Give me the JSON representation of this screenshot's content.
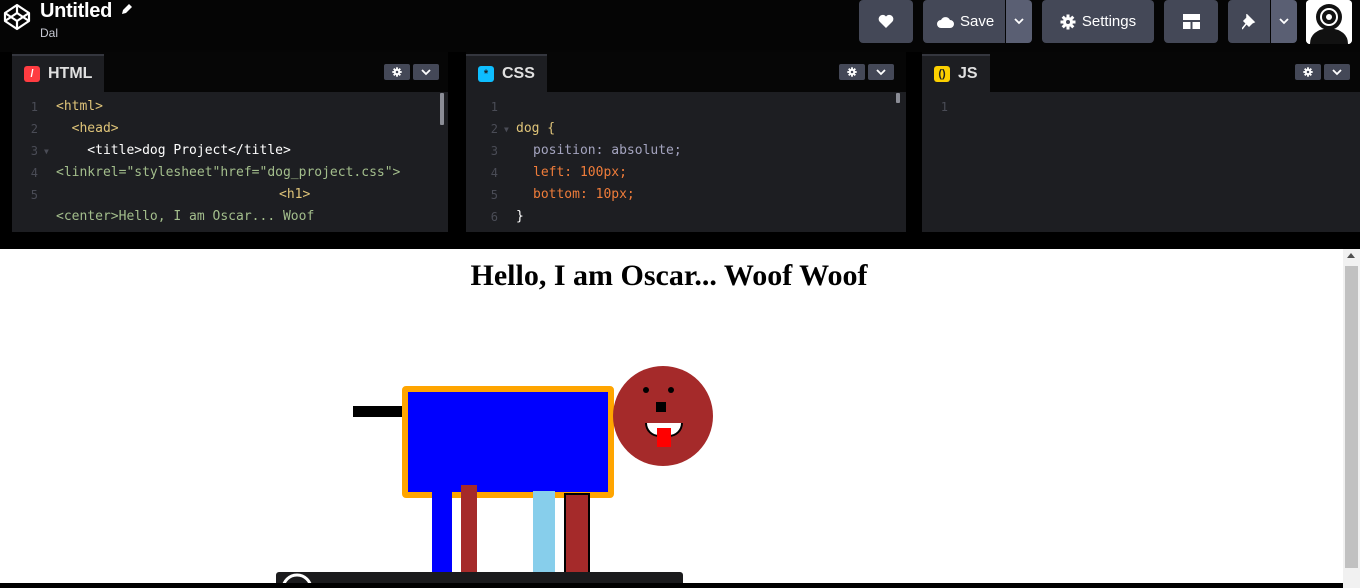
{
  "header": {
    "title": "Untitled",
    "author": "Dal",
    "buttons": {
      "save": "Save",
      "settings": "Settings"
    }
  },
  "editors": {
    "html": {
      "label": "HTML",
      "lines": [
        {
          "n": "1",
          "text": "<html>"
        },
        {
          "n": "2",
          "text": "  <head>"
        },
        {
          "n": "3",
          "text": "    <title>dog Project</title>"
        },
        {
          "n": "4",
          "text": "<linkrel=\"stylesheet\"href=\"dog_project.css\">"
        },
        {
          "n": "5",
          "text": "<h1>"
        },
        {
          "n": "",
          "text": "<center>Hello, I am Oscar... Woof"
        }
      ]
    },
    "css": {
      "label": "CSS",
      "lines": [
        {
          "n": "1",
          "text": ""
        },
        {
          "n": "2",
          "text": "dog {"
        },
        {
          "n": "3",
          "text": "position: absolute;"
        },
        {
          "n": "4",
          "text": "left: 100px;"
        },
        {
          "n": "5",
          "text": "bottom: 10px;"
        },
        {
          "n": "6",
          "text": "}"
        }
      ]
    },
    "js": {
      "label": "JS",
      "lines": [
        {
          "n": "1",
          "text": ""
        }
      ]
    }
  },
  "preview": {
    "heading": "Hello, I am Oscar... Woof Woof"
  },
  "colors": {
    "dog_body": "#0000ff",
    "dog_border": "#ffa500",
    "dog_head": "#a52a2a",
    "tongue": "#ff0000",
    "leg_blue": "#0000ff",
    "leg_brown": "#a52a2a",
    "leg_lightblue": "#87ceeb",
    "tail": "#000000"
  }
}
